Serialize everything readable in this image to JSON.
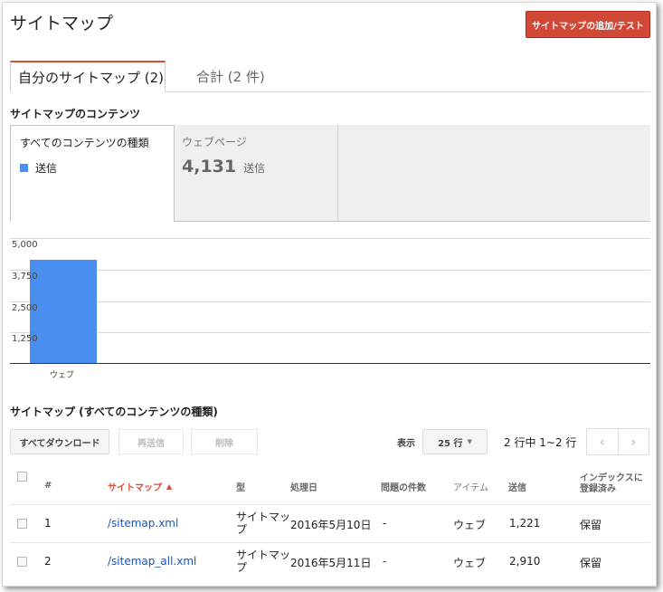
{
  "page": {
    "title": "サイトマップ",
    "add_button": "サイトマップの追加/テスト"
  },
  "tabs": [
    {
      "label": "自分のサイトマップ (2)",
      "active": true
    },
    {
      "label": "合計 (2 件)",
      "active": false
    }
  ],
  "contents": {
    "heading": "サイトマップのコンテンツ",
    "selector_label": "すべてのコンテンツの種類",
    "legend_label": "送信",
    "web_label": "ウェブページ",
    "web_value": "4,131",
    "web_unit": "送信"
  },
  "chart_data": {
    "type": "bar",
    "categories": [
      "ウェブ"
    ],
    "series": [
      {
        "name": "送信",
        "values": [
          4131
        ],
        "color": "#4a8ff0"
      }
    ],
    "yticks": [
      "5,000",
      "3,750",
      "2,500",
      "1,250"
    ],
    "ylim": [
      0,
      5000
    ],
    "grid": true
  },
  "table_section": {
    "heading": "サイトマップ (すべてのコンテンツの種類)",
    "download_button": "すべてダウンロード",
    "resubmit_button": "再送信",
    "delete_button": "削除",
    "show_label": "表示",
    "rows_select": "25 行",
    "pagination_text": "2 行中 1~2 行"
  },
  "table": {
    "headers": {
      "num": "#",
      "sitemap": "サイトマップ",
      "type": "型",
      "processed": "処理日",
      "issues": "問題の件数",
      "item": "アイテム",
      "submitted": "送信",
      "indexed_1": "インデックスに",
      "indexed_2": "登録済み"
    },
    "rows": [
      {
        "num": "1",
        "sitemap": "/sitemap.xml",
        "type_1": "サイトマッ",
        "type_2": "プ",
        "processed": "2016年5月10日",
        "issues": "-",
        "item": "ウェブ",
        "submitted": "1,221",
        "indexed": "保留"
      },
      {
        "num": "2",
        "sitemap": "/sitemap_all.xml",
        "type_1": "サイトマッ",
        "type_2": "プ",
        "processed": "2016年5月11日",
        "issues": "-",
        "item": "ウェブ",
        "submitted": "2,910",
        "indexed": "保留"
      }
    ]
  }
}
